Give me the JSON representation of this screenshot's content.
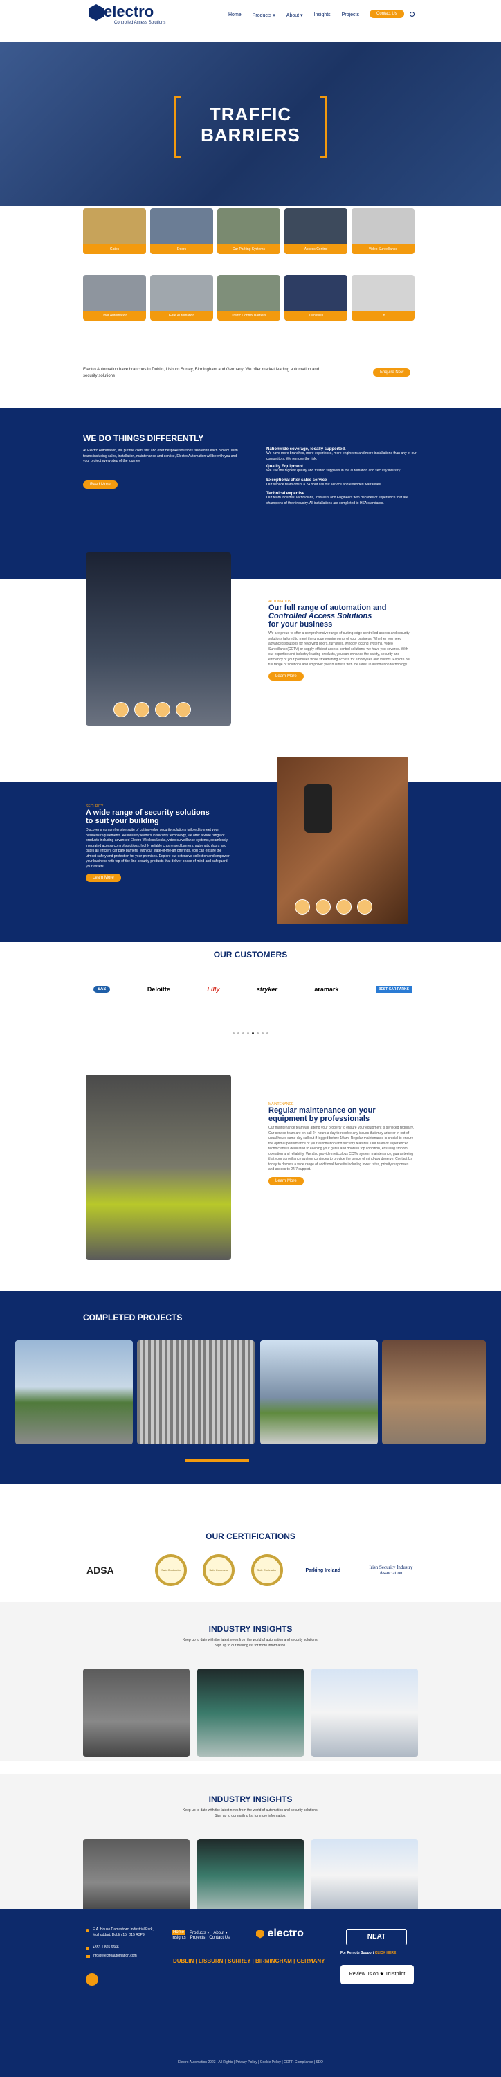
{
  "header": {
    "logo_text": "electro",
    "logo_sub": "Controlled Access Solutions",
    "nav": [
      "Home",
      "Products ▾",
      "About ▾",
      "Insights",
      "Projects"
    ],
    "cta": "Contact Us"
  },
  "hero": {
    "title_line1": "TRAFFIC",
    "title_line2": "BARRIERS"
  },
  "tiles": [
    "Gates",
    "Doors",
    "Car Parking Systems",
    "Access Control",
    "Video Surveillance",
    "Door Automation",
    "Gate Automation",
    "Traffic Control Barriers",
    "Turnstiles",
    "Lift"
  ],
  "intro": {
    "text": "Electro Automation have branches in Dublin, Lisburn Surrey, Birmingham and Germany. We offer market leading automation and security solutions",
    "cta": "Enquire Now"
  },
  "different": {
    "title": "WE DO THINGS DIFFERENTLY",
    "text": "At Electro Automation, we put the client first and offer bespoke solutions tailored to each project. With teams including sales, installation, maintenance and service, Electro Automation will be with you and your project every step of the journey.",
    "cta": "Read More",
    "points": [
      {
        "h": "Nationwide coverage, locally supported.",
        "t": "We have more branches, more experience, more engineers and more installations than any of our competitors. We remove the risk."
      },
      {
        "h": "Quality Equipment",
        "t": "We use the highest quality and trusted suppliers in the automation and security industry."
      },
      {
        "h": "Exceptional after sales service",
        "t": "Our service team offers a 24 hour call out service and extended warranties."
      },
      {
        "h": "Technical expertise",
        "t": "Our team includes Technicians, Installers and Engineers with decades of experience that are champions of their industry. All installations are completed to HSA standards."
      }
    ]
  },
  "automation": {
    "eyebrow": "AUTOMATION",
    "title1": "Our full range of automation and",
    "title2": "Controlled Access Solutions",
    "title3": "for your business",
    "text": "We are proud to offer a comprehensive range of cutting-edge controlled access and security solutions tailored to meet the unique requirements of your business. Whether you need advanced solutions for revolving doors, turnstiles, window locking systems, Video Surveillance(CCTV) or supply efficient access control solutions, we have you covered. With our expertise and industry-leading products, you can enhance the safety, security and efficiency of your premises while streamlining access for employees and visitors. Explore our full range of solutions and empower your business with the latest in automation technology.",
    "cta": "Learn More"
  },
  "security": {
    "eyebrow": "SECURITY",
    "title1": "A wide range of security solutions",
    "title2": "to suit your building",
    "text": "Discover a comprehensive suite of cutting-edge security solutions tailored to meet your business requirements. As industry leaders in security technology, we offer a wide range of products including advanced Electro Wireless Locks, video surveillance systems, seamlessly integrated access control solutions, highly reliable crash-rated barriers, automatic doors and gates all efficient car park barriers. With our state-of-the-art offerings, you can ensure the utmost safety and protection for your premises. Explore our extensive collection and empower your business with top-of-the-line security products that deliver peace of mind and safeguard your assets.",
    "cta": "Learn More"
  },
  "customers": {
    "title": "OUR CUSTOMERS",
    "logos": [
      "SAS",
      "Deloitte",
      "Lilly",
      "stryker",
      "aramark",
      "BEST CAR PARKS"
    ]
  },
  "maintenance": {
    "eyebrow": "MAINTENANCE",
    "title1": "Regular maintenance on your",
    "title2": "equipment by professionals",
    "text": "Our maintenance team will attend your property to ensure your equipment is serviced regularly. Our service team are on call 24 hours a day to resolve any issues that may arise or in out-of-usual hours same day call out if logged before 10am. Regular maintenance is crucial to ensure the optimal performance of your automation and security features. Our team of experienced technicians is dedicated to keeping your gates and doors in top condition, ensuring smooth operation and reliability. We also provide meticulous CCTV system maintenance, guaranteeing that your surveillance system continues to provide the peace of mind you deserve. Contact Us today to discuss a wide range of additional benefits including lower rates, priority responses and access to 24/7 support.",
    "cta": "Learn More"
  },
  "projects": {
    "title": "COMPLETED PROJECTS"
  },
  "certs": {
    "title": "OUR CERTIFICATIONS",
    "logos": [
      "ADSA",
      "Safe Contractor",
      "Safe Contractor",
      "Safe Contractor",
      "Parking Ireland",
      "Irish Security Industry Association"
    ]
  },
  "insights1": {
    "title": "INDUSTRY INSIGHTS",
    "text": "Keep up to date with the latest news from the world of automation and security solutions. Sign up to our mailing list for more information."
  },
  "insights2": {
    "title": "INDUSTRY INSIGHTS",
    "text": "Keep up to date with the latest news from the world of automation and security solutions. Sign up to our mailing list for more information."
  },
  "footer": {
    "address": "E.A. House Damastown Industrial Park, Mulhuddart, Dublin 15, D15 R3P9",
    "phone": "+353 1 865 6666",
    "email": "info@electroautomation.com",
    "links1": [
      "Home",
      "Products ▾",
      "About ▾"
    ],
    "links2": [
      "Insights",
      "Projects",
      "Contact Us"
    ],
    "logo": "electro",
    "branches": "DUBLIN | LISBURN | SURREY | BIRMINGHAM | GERMANY",
    "support": "For Remote Support",
    "support_link": "CLICK HERE",
    "neat": "NEAT",
    "trustpilot": "Review us on ★ Trustpilot",
    "copy": "Electro Automation 2023 | All Rights | Privacy Policy | Cookie Policy | GDPR Compliance | SEO"
  },
  "colors": {
    "navy": "#0d2a6b",
    "orange": "#f39a0e"
  }
}
